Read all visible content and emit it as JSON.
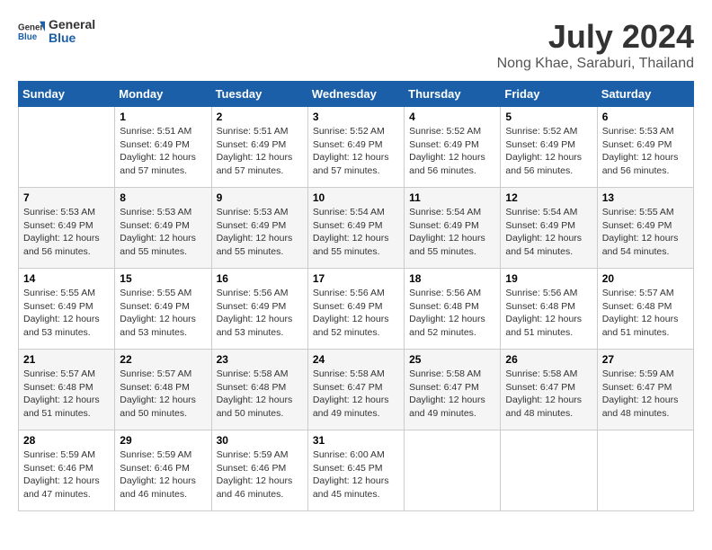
{
  "header": {
    "logo_general": "General",
    "logo_blue": "Blue",
    "month": "July 2024",
    "location": "Nong Khae, Saraburi, Thailand"
  },
  "weekdays": [
    "Sunday",
    "Monday",
    "Tuesday",
    "Wednesday",
    "Thursday",
    "Friday",
    "Saturday"
  ],
  "weeks": [
    [
      {
        "day": "",
        "info": ""
      },
      {
        "day": "1",
        "info": "Sunrise: 5:51 AM\nSunset: 6:49 PM\nDaylight: 12 hours\nand 57 minutes."
      },
      {
        "day": "2",
        "info": "Sunrise: 5:51 AM\nSunset: 6:49 PM\nDaylight: 12 hours\nand 57 minutes."
      },
      {
        "day": "3",
        "info": "Sunrise: 5:52 AM\nSunset: 6:49 PM\nDaylight: 12 hours\nand 57 minutes."
      },
      {
        "day": "4",
        "info": "Sunrise: 5:52 AM\nSunset: 6:49 PM\nDaylight: 12 hours\nand 56 minutes."
      },
      {
        "day": "5",
        "info": "Sunrise: 5:52 AM\nSunset: 6:49 PM\nDaylight: 12 hours\nand 56 minutes."
      },
      {
        "day": "6",
        "info": "Sunrise: 5:53 AM\nSunset: 6:49 PM\nDaylight: 12 hours\nand 56 minutes."
      }
    ],
    [
      {
        "day": "7",
        "info": "Sunrise: 5:53 AM\nSunset: 6:49 PM\nDaylight: 12 hours\nand 56 minutes."
      },
      {
        "day": "8",
        "info": "Sunrise: 5:53 AM\nSunset: 6:49 PM\nDaylight: 12 hours\nand 55 minutes."
      },
      {
        "day": "9",
        "info": "Sunrise: 5:53 AM\nSunset: 6:49 PM\nDaylight: 12 hours\nand 55 minutes."
      },
      {
        "day": "10",
        "info": "Sunrise: 5:54 AM\nSunset: 6:49 PM\nDaylight: 12 hours\nand 55 minutes."
      },
      {
        "day": "11",
        "info": "Sunrise: 5:54 AM\nSunset: 6:49 PM\nDaylight: 12 hours\nand 55 minutes."
      },
      {
        "day": "12",
        "info": "Sunrise: 5:54 AM\nSunset: 6:49 PM\nDaylight: 12 hours\nand 54 minutes."
      },
      {
        "day": "13",
        "info": "Sunrise: 5:55 AM\nSunset: 6:49 PM\nDaylight: 12 hours\nand 54 minutes."
      }
    ],
    [
      {
        "day": "14",
        "info": "Sunrise: 5:55 AM\nSunset: 6:49 PM\nDaylight: 12 hours\nand 53 minutes."
      },
      {
        "day": "15",
        "info": "Sunrise: 5:55 AM\nSunset: 6:49 PM\nDaylight: 12 hours\nand 53 minutes."
      },
      {
        "day": "16",
        "info": "Sunrise: 5:56 AM\nSunset: 6:49 PM\nDaylight: 12 hours\nand 53 minutes."
      },
      {
        "day": "17",
        "info": "Sunrise: 5:56 AM\nSunset: 6:49 PM\nDaylight: 12 hours\nand 52 minutes."
      },
      {
        "day": "18",
        "info": "Sunrise: 5:56 AM\nSunset: 6:48 PM\nDaylight: 12 hours\nand 52 minutes."
      },
      {
        "day": "19",
        "info": "Sunrise: 5:56 AM\nSunset: 6:48 PM\nDaylight: 12 hours\nand 51 minutes."
      },
      {
        "day": "20",
        "info": "Sunrise: 5:57 AM\nSunset: 6:48 PM\nDaylight: 12 hours\nand 51 minutes."
      }
    ],
    [
      {
        "day": "21",
        "info": "Sunrise: 5:57 AM\nSunset: 6:48 PM\nDaylight: 12 hours\nand 51 minutes."
      },
      {
        "day": "22",
        "info": "Sunrise: 5:57 AM\nSunset: 6:48 PM\nDaylight: 12 hours\nand 50 minutes."
      },
      {
        "day": "23",
        "info": "Sunrise: 5:58 AM\nSunset: 6:48 PM\nDaylight: 12 hours\nand 50 minutes."
      },
      {
        "day": "24",
        "info": "Sunrise: 5:58 AM\nSunset: 6:47 PM\nDaylight: 12 hours\nand 49 minutes."
      },
      {
        "day": "25",
        "info": "Sunrise: 5:58 AM\nSunset: 6:47 PM\nDaylight: 12 hours\nand 49 minutes."
      },
      {
        "day": "26",
        "info": "Sunrise: 5:58 AM\nSunset: 6:47 PM\nDaylight: 12 hours\nand 48 minutes."
      },
      {
        "day": "27",
        "info": "Sunrise: 5:59 AM\nSunset: 6:47 PM\nDaylight: 12 hours\nand 48 minutes."
      }
    ],
    [
      {
        "day": "28",
        "info": "Sunrise: 5:59 AM\nSunset: 6:46 PM\nDaylight: 12 hours\nand 47 minutes."
      },
      {
        "day": "29",
        "info": "Sunrise: 5:59 AM\nSunset: 6:46 PM\nDaylight: 12 hours\nand 46 minutes."
      },
      {
        "day": "30",
        "info": "Sunrise: 5:59 AM\nSunset: 6:46 PM\nDaylight: 12 hours\nand 46 minutes."
      },
      {
        "day": "31",
        "info": "Sunrise: 6:00 AM\nSunset: 6:45 PM\nDaylight: 12 hours\nand 45 minutes."
      },
      {
        "day": "",
        "info": ""
      },
      {
        "day": "",
        "info": ""
      },
      {
        "day": "",
        "info": ""
      }
    ]
  ]
}
